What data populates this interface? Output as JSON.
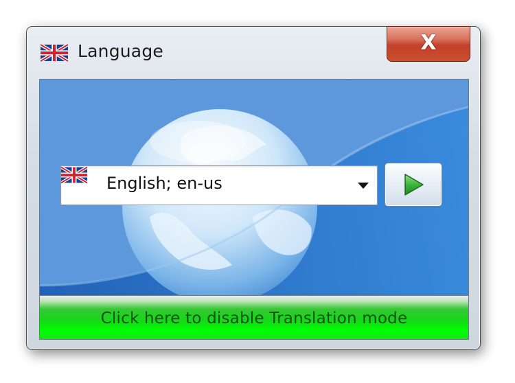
{
  "window": {
    "title": "Language",
    "title_icon": "uk-flag-icon",
    "close_icon": "close-icon",
    "close_glyph": "X"
  },
  "language_selector": {
    "selected_value": "English; en-us",
    "flag_icon": "uk-flag-icon",
    "dropdown_icon": "chevron-down-icon"
  },
  "apply_button": {
    "icon": "play-arrow-icon"
  },
  "translation_bar": {
    "label": "Click here to disable Translation mode"
  },
  "colors": {
    "background_blue": "#3d7ccc",
    "bar_green": "#00ff00",
    "close_red": "#c4402a",
    "play_green": "#3cb33a"
  }
}
